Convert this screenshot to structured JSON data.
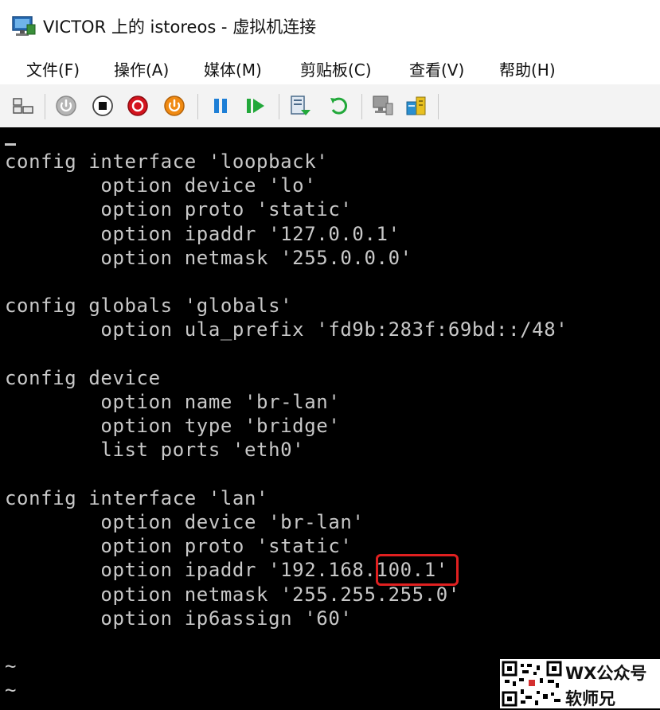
{
  "window": {
    "title": "VICTOR 上的 istoreos - 虚拟机连接"
  },
  "menu": {
    "items": [
      "文件(F)",
      "操作(A)",
      "媒体(M)",
      "剪贴板(C)",
      "查看(V)",
      "帮助(H)"
    ]
  },
  "toolbar": {
    "buttons": [
      {
        "icon": "ctrl-alt-del-icon"
      },
      {
        "icon": "start-icon"
      },
      {
        "icon": "turn-off-icon"
      },
      {
        "icon": "shutdown-icon"
      },
      {
        "icon": "power-icon"
      },
      {
        "icon": "pause-icon"
      },
      {
        "icon": "resume-icon"
      },
      {
        "icon": "checkpoint-icon"
      },
      {
        "icon": "revert-icon"
      },
      {
        "icon": "enhanced-session-icon"
      },
      {
        "icon": "share-icon"
      }
    ]
  },
  "terminal": {
    "lines": [
      "config interface 'loopback'",
      "        option device 'lo'",
      "        option proto 'static'",
      "        option ipaddr '127.0.0.1'",
      "        option netmask '255.0.0.0'",
      "",
      "config globals 'globals'",
      "        option ula_prefix 'fd9b:283f:69bd::/48'",
      "",
      "config device",
      "        option name 'br-lan'",
      "        option type 'bridge'",
      "        list ports 'eth0'",
      "",
      "config interface 'lan'",
      "        option device 'br-lan'",
      "        option proto 'static'",
      "        option ipaddr '192.168.100.1'",
      "        option netmask '255.255.255.0'",
      "        option ip6assign '60'",
      "",
      "~",
      "~",
      "~"
    ],
    "highlighted_text": "100.1'"
  },
  "watermark": {
    "line1": "WX公众号",
    "line2": "软师兄"
  },
  "colors": {
    "terminal_bg": "#000000",
    "terminal_fg": "#c8c8c8",
    "highlight": "#e02020"
  }
}
